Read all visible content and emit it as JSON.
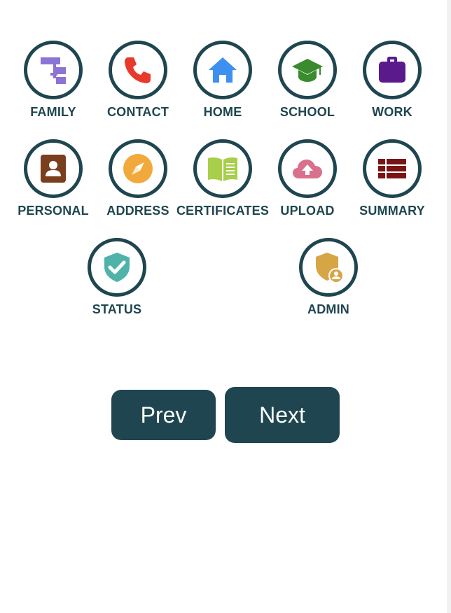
{
  "tiles": [
    {
      "label": "FAMILY",
      "icon": "sitemap-icon",
      "color": "#8c73d6"
    },
    {
      "label": "CONTACT",
      "icon": "phone-icon",
      "color": "#e83a2c"
    },
    {
      "label": "HOME",
      "icon": "home-icon",
      "color": "#3d8ff0"
    },
    {
      "label": "SCHOOL",
      "icon": "graduation-cap-icon",
      "color": "#3a8a2e"
    },
    {
      "label": "WORK",
      "icon": "briefcase-icon",
      "color": "#5a1a8c"
    },
    {
      "label": "PERSONAL",
      "icon": "contact-card-icon",
      "color": "#7a3f1c"
    },
    {
      "label": "ADDRESS",
      "icon": "compass-icon",
      "color": "#f2a93b"
    },
    {
      "label": "CERTIFICATES",
      "icon": "open-book-icon",
      "color": "#a8cf4a"
    },
    {
      "label": "UPLOAD",
      "icon": "cloud-upload-icon",
      "color": "#d9708c"
    },
    {
      "label": "SUMMARY",
      "icon": "list-icon",
      "color": "#7a1414"
    },
    {
      "label": "STATUS",
      "icon": "shield-check-icon",
      "color": "#4fb3a9"
    },
    {
      "label": "ADMIN",
      "icon": "shield-user-icon",
      "color": "#d6a545"
    }
  ],
  "buttons": {
    "prev": "Prev",
    "next": "Next"
  },
  "colors": {
    "primary": "#1f4650",
    "background": "#ffffff"
  }
}
